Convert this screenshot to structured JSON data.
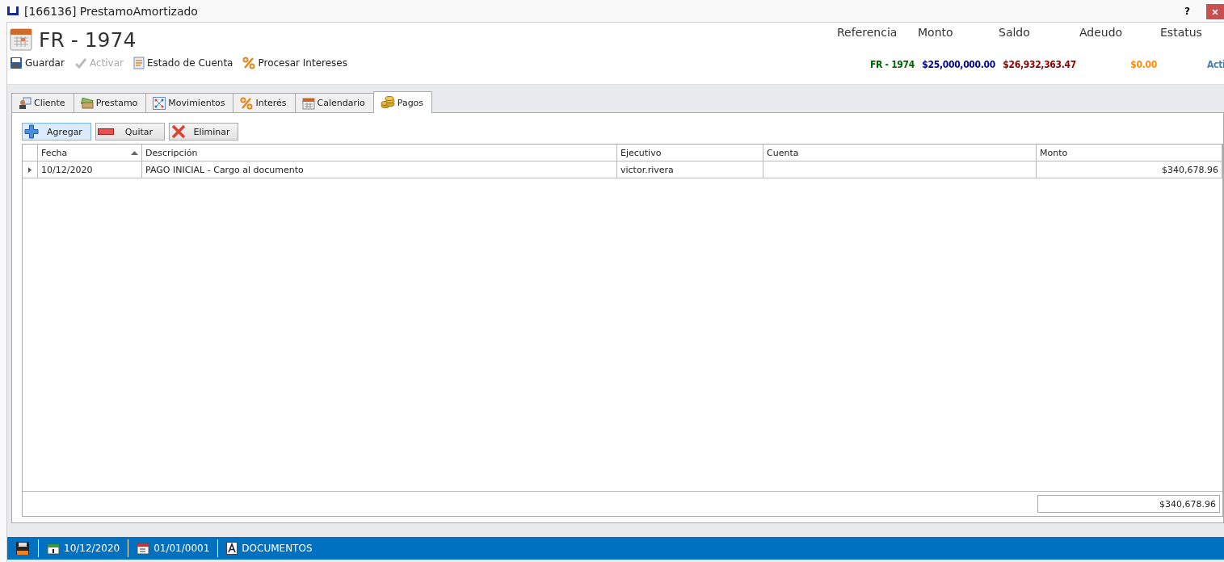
{
  "window": {
    "title": "[166136] PrestamoAmortizado",
    "help": "?"
  },
  "header": {
    "title": "FR - 1974"
  },
  "toolbar": [
    {
      "label": "Guardar",
      "kind": "save",
      "disabled": false
    },
    {
      "label": "Activar",
      "kind": "check",
      "disabled": true
    },
    {
      "label": "Estado de Cuenta",
      "kind": "report",
      "disabled": false
    },
    {
      "label": "Procesar Intereses",
      "kind": "percent",
      "disabled": false
    }
  ],
  "summary": [
    {
      "label": "Referencia",
      "value": "FR - 1974",
      "color": "#006400"
    },
    {
      "label": "Monto",
      "value": "$25,000,000.00",
      "color": "#00008b"
    },
    {
      "label": "Saldo",
      "value": "$26,932,363.47",
      "color": "#8b0000"
    },
    {
      "label": "Adeudo",
      "value": "$0.00",
      "color": "#ff8c00"
    },
    {
      "label": "Estatus",
      "value": "Acti",
      "color": "#4682b4"
    }
  ],
  "tabs": [
    {
      "label": "Cliente",
      "kind": "person",
      "selected": false
    },
    {
      "label": "Prestamo",
      "kind": "money",
      "selected": false
    },
    {
      "label": "Movimientos",
      "kind": "nodes",
      "selected": false
    },
    {
      "label": "Interés",
      "kind": "percent",
      "selected": false
    },
    {
      "label": "Calendario",
      "kind": "calendar",
      "selected": false
    },
    {
      "label": "Pagos",
      "kind": "coins",
      "selected": true
    }
  ],
  "actions": [
    {
      "label": "Agregar",
      "kind": "add",
      "focused": true
    },
    {
      "label": "Quitar",
      "kind": "remove",
      "focused": false
    },
    {
      "label": "Eliminar",
      "kind": "delete",
      "focused": false
    }
  ],
  "table": {
    "columns": [
      {
        "label": "Fecha",
        "sorted": true
      },
      {
        "label": "Descripción",
        "sorted": false
      },
      {
        "label": "Ejecutivo",
        "sorted": false
      },
      {
        "label": "Cuenta",
        "sorted": false
      },
      {
        "label": "Monto",
        "sorted": false
      }
    ],
    "rows": [
      {
        "selected": true,
        "cells": [
          "10/12/2020",
          "PAGO INICIAL - Cargo al documento",
          "victor.rivera",
          "",
          "$340,678.96"
        ]
      }
    ],
    "total": "$340,678.96"
  },
  "status_bar": [
    {
      "kind": "save"
    },
    {
      "kind": "date",
      "text": "10/12/2020"
    },
    {
      "kind": "calendar",
      "text": "01/01/0001"
    },
    {
      "kind": "font",
      "text": "DOCUMENTOS"
    }
  ]
}
